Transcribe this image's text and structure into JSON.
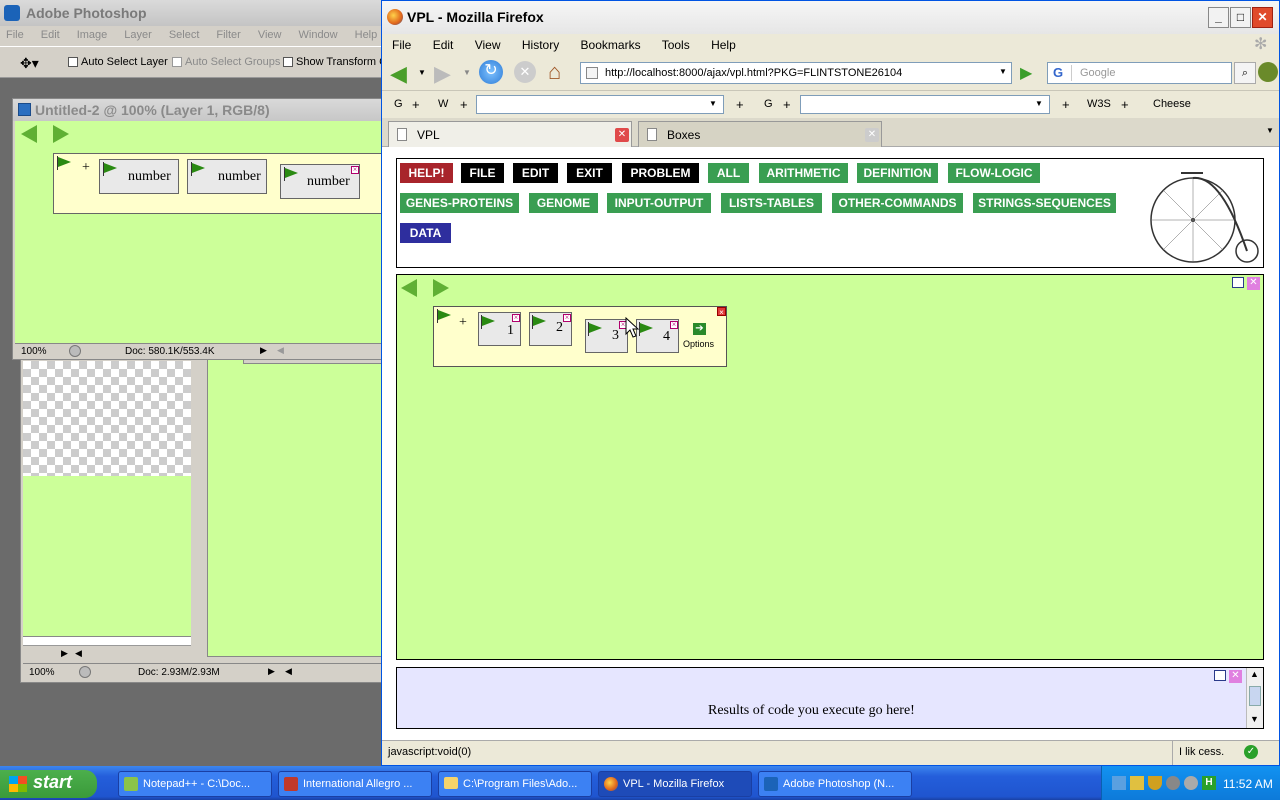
{
  "photoshop": {
    "title": "Adobe Photoshop",
    "menu": [
      "File",
      "Edit",
      "Image",
      "Layer",
      "Select",
      "Filter",
      "View",
      "Window",
      "Help"
    ],
    "options": {
      "auto_select_layer": "Auto Select Layer",
      "auto_select_groups": "Auto Select Groups",
      "show_transform": "Show Transform C"
    },
    "doc1": {
      "title": "Untitled-2 @ 100% (Layer 1, RGB/8)",
      "zoom": "100%",
      "doc_size": "Doc: 580.1K/553.4K",
      "plus": "+",
      "boxes": [
        "number",
        "number",
        "number"
      ]
    },
    "doc2": {
      "zoom": "100%",
      "doc_size": "Doc: 2.93M/2.93M"
    }
  },
  "firefox": {
    "title": "VPL - Mozilla Firefox",
    "menu": [
      "File",
      "Edit",
      "View",
      "History",
      "Bookmarks",
      "Tools",
      "Help"
    ],
    "url": "http://localhost:8000/ajax/vpl.html?PKG=FLINTSTONE26104",
    "search_placeholder": "Google",
    "bookmarks": {
      "g1": "G",
      "plus1": "+",
      "w": "W",
      "plus2": "+",
      "plus3": "+",
      "g2": "G",
      "plus4": "+",
      "plus5": "+",
      "w3s": "W3S",
      "plus6": "+",
      "cheese": "Cheese"
    },
    "tabs": [
      "VPL",
      "Boxes"
    ],
    "status_left": "javascript:void(0)",
    "status_right": "I lik cess."
  },
  "vpl": {
    "buttons_row1": [
      {
        "label": "HELP!",
        "color": "#a8242b"
      },
      {
        "label": "FILE",
        "color": "#000000"
      },
      {
        "label": "EDIT",
        "color": "#000000"
      },
      {
        "label": "EXIT",
        "color": "#000000"
      },
      {
        "label": "PROBLEM",
        "color": "#000000"
      },
      {
        "label": "ALL",
        "color": "#3a9e52"
      },
      {
        "label": "ARITHMETIC",
        "color": "#3a9e52"
      },
      {
        "label": "DEFINITION",
        "color": "#3a9e52"
      },
      {
        "label": "FLOW-LOGIC",
        "color": "#3a9e52"
      }
    ],
    "buttons_row2": [
      "GENES-PROTEINS",
      "GENOME",
      "INPUT-OUTPUT",
      "LISTS-TABLES",
      "OTHER-COMMANDS",
      "STRINGS-SEQUENCES"
    ],
    "buttons_row3": [
      "DATA"
    ],
    "workspace": {
      "plus": "+",
      "boxes": [
        "1",
        "2",
        "3",
        "4"
      ],
      "options_label": "Options"
    },
    "results_text": "Results of code you execute go here!"
  },
  "taskbar": {
    "start": "start",
    "tasks": [
      "Notepad++ - C:\\Doc...",
      "International Allegro ...",
      "C:\\Program Files\\Ado...",
      "VPL - Mozilla Firefox",
      "Adobe Photoshop (N..."
    ],
    "clock": "11:52 AM"
  }
}
